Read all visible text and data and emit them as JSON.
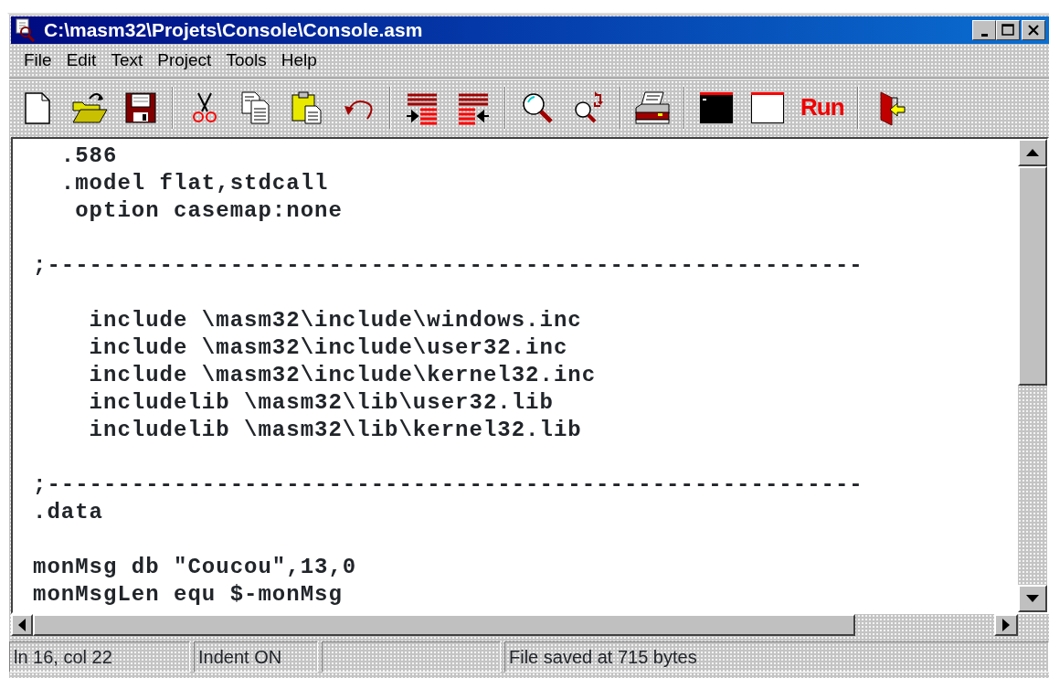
{
  "window": {
    "title": "C:\\masm32\\Projets\\Console\\Console.asm"
  },
  "menu": [
    {
      "label": "File"
    },
    {
      "label": "Edit"
    },
    {
      "label": "Text"
    },
    {
      "label": "Project"
    },
    {
      "label": "Tools"
    },
    {
      "label": "Help"
    }
  ],
  "toolbar": {
    "run_label": "Run"
  },
  "editor": {
    "lines": [
      {
        "kind": "code",
        "text": "  .586"
      },
      {
        "kind": "code",
        "text": "  .model flat,stdcall"
      },
      {
        "kind": "code",
        "text": "   option casemap:none"
      },
      {
        "kind": "blank"
      },
      {
        "kind": "code",
        "text": ";----------------------------------------------------------"
      },
      {
        "kind": "blank"
      },
      {
        "kind": "code",
        "text": "    include \\masm32\\include\\windows.inc"
      },
      {
        "kind": "code",
        "text": "    include \\masm32\\include\\user32.inc"
      },
      {
        "kind": "code",
        "text": "    include \\masm32\\include\\kernel32.inc"
      },
      {
        "kind": "code",
        "text": "    includelib \\masm32\\lib\\user32.lib"
      },
      {
        "kind": "code",
        "text": "    includelib \\masm32\\lib\\kernel32.lib"
      },
      {
        "kind": "blank"
      },
      {
        "kind": "code",
        "text": ";----------------------------------------------------------"
      },
      {
        "kind": "code",
        "text": ".data"
      },
      {
        "kind": "blank"
      },
      {
        "kind": "code",
        "text": "monMsg db \"Coucou\",13,0"
      },
      {
        "kind": "code",
        "text": "monMsgLen equ $-monMsg"
      }
    ]
  },
  "status_bar": [
    {
      "kind": "text",
      "text": "ln 16, col 22"
    },
    {
      "kind": "text",
      "text": "Indent ON"
    },
    {
      "kind": "empty"
    },
    {
      "kind": "text",
      "text": "File saved at 715 bytes"
    }
  ]
}
